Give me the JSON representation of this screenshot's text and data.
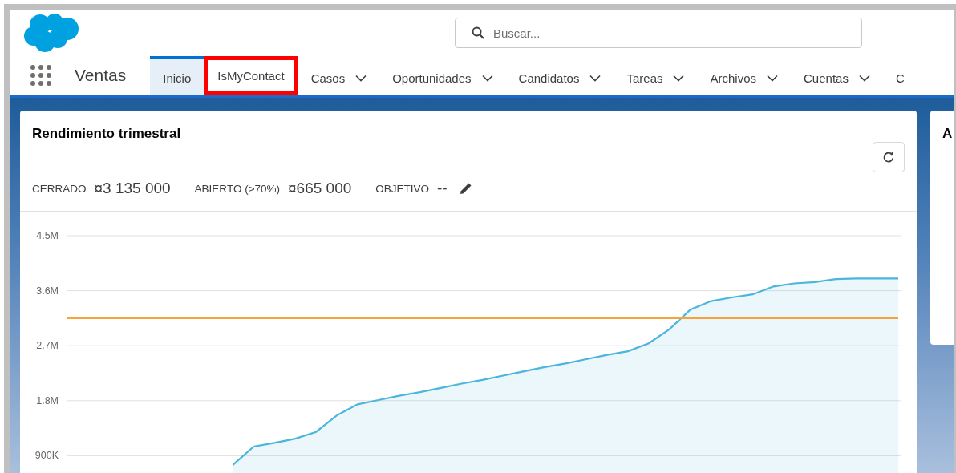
{
  "header": {
    "search": {
      "placeholder": "Buscar..."
    }
  },
  "nav": {
    "app_name": "Ventas",
    "tabs": [
      {
        "label": "Inicio",
        "selected": true,
        "highlighted": false,
        "dropdown": false
      },
      {
        "label": "IsMyContact",
        "selected": false,
        "highlighted": true,
        "dropdown": false
      },
      {
        "label": "Casos",
        "selected": false,
        "highlighted": false,
        "dropdown": true
      },
      {
        "label": "Oportunidades",
        "selected": false,
        "highlighted": false,
        "dropdown": true
      },
      {
        "label": "Candidatos",
        "selected": false,
        "highlighted": false,
        "dropdown": true
      },
      {
        "label": "Tareas",
        "selected": false,
        "highlighted": false,
        "dropdown": true
      },
      {
        "label": "Archivos",
        "selected": false,
        "highlighted": false,
        "dropdown": true
      },
      {
        "label": "Cuentas",
        "selected": false,
        "highlighted": false,
        "dropdown": true
      },
      {
        "label": "C",
        "selected": false,
        "highlighted": false,
        "dropdown": false
      }
    ]
  },
  "performance_card": {
    "title": "Rendimiento trimestral",
    "metrics": [
      {
        "label": "CERRADO",
        "value": "¤3 135 000",
        "editable": false
      },
      {
        "label": "ABIERTO (>70%)",
        "value": "¤665 000",
        "editable": false
      },
      {
        "label": "OBJETIVO",
        "value": "--",
        "editable": true
      }
    ],
    "chart_data": {
      "type": "area",
      "categories": [
        null,
        null,
        null,
        null,
        null,
        null,
        null,
        null,
        null,
        null,
        null,
        null,
        null,
        null,
        null,
        null,
        null,
        null,
        null,
        null,
        null,
        null,
        null,
        null,
        null,
        null,
        null,
        null,
        null,
        null,
        null,
        null,
        null,
        null,
        null,
        null,
        null,
        null,
        null,
        null,
        null
      ],
      "ylim": [
        0,
        4500000
      ],
      "yticks": [
        {
          "value": 900000,
          "label": "900K"
        },
        {
          "value": 1800000,
          "label": "1.8M"
        },
        {
          "value": 2700000,
          "label": "2.7M"
        },
        {
          "value": 3600000,
          "label": "3.6M"
        },
        {
          "value": 4500000,
          "label": "4.5M"
        }
      ],
      "series": [
        {
          "color": "#4bb5dc",
          "values": [
            null,
            null,
            null,
            null,
            null,
            null,
            null,
            null,
            750000,
            1050000,
            1110000,
            1180000,
            1290000,
            1560000,
            1740000,
            1810000,
            1880000,
            1940000,
            2010000,
            2080000,
            2140000,
            2210000,
            2280000,
            2350000,
            2410000,
            2480000,
            2550000,
            2610000,
            2740000,
            2970000,
            3290000,
            3430000,
            3490000,
            3540000,
            3670000,
            3720000,
            3740000,
            3790000,
            3800000,
            3800000,
            3800000
          ]
        },
        {
          "type": "line",
          "color": "#f9a13a",
          "values": [
            3150000,
            3150000,
            3150000,
            3150000,
            3150000,
            3150000,
            3150000,
            3150000,
            3150000,
            3150000,
            3150000,
            3150000,
            3150000,
            3150000,
            3150000,
            3150000,
            3150000,
            3150000,
            3150000,
            3150000,
            3150000,
            3150000,
            3150000,
            3150000,
            3150000,
            3150000,
            3150000,
            3150000,
            3150000,
            3150000,
            3150000,
            3150000,
            3150000,
            3150000,
            3150000,
            3150000,
            3150000,
            3150000,
            3150000,
            3150000,
            3150000
          ]
        }
      ],
      "grid": true
    }
  },
  "side_card": {
    "title": "A"
  }
}
